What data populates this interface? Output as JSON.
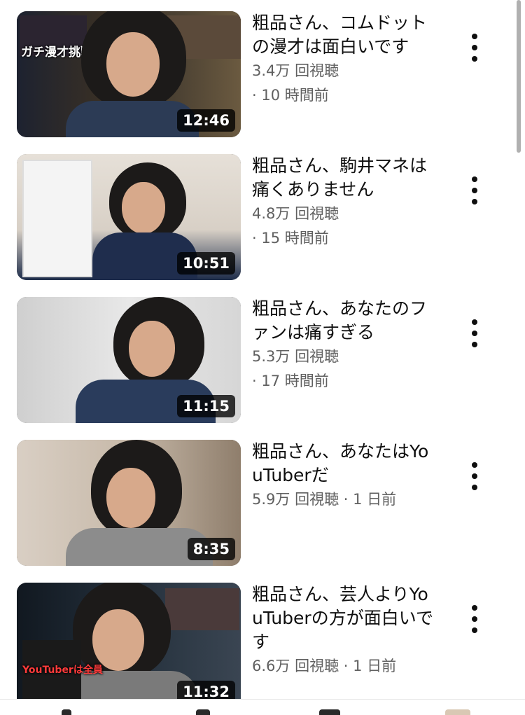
{
  "videos": [
    {
      "title": "粗品さん、コムドットの漫才は面白いです",
      "views": "3.4万 回視聴",
      "age": "· 10 時間前",
      "duration": "12:46",
      "thumb_caption": "ガチ漫才挑戦"
    },
    {
      "title": "粗品さん、駒井マネは痛くありません",
      "views": "4.8万 回視聴",
      "age": "· 15 時間前",
      "duration": "10:51"
    },
    {
      "title": "粗品さん、あなたのファンは痛すぎる",
      "views": "5.3万 回視聴",
      "age": "· 17 時間前",
      "duration": "11:15"
    },
    {
      "title": "粗品さん、あなたはYouTuberだ",
      "views": "5.9万 回視聴 · 1 日前",
      "duration": "8:35"
    },
    {
      "title": "粗品さん、芸人よりYouTuberの方が面白いです",
      "views": "6.6万 回視聴 · 1 日前",
      "duration": "11:32",
      "thumb_caption": "YouTuberは全員"
    }
  ],
  "icons": {
    "more": "more-vert-icon"
  }
}
